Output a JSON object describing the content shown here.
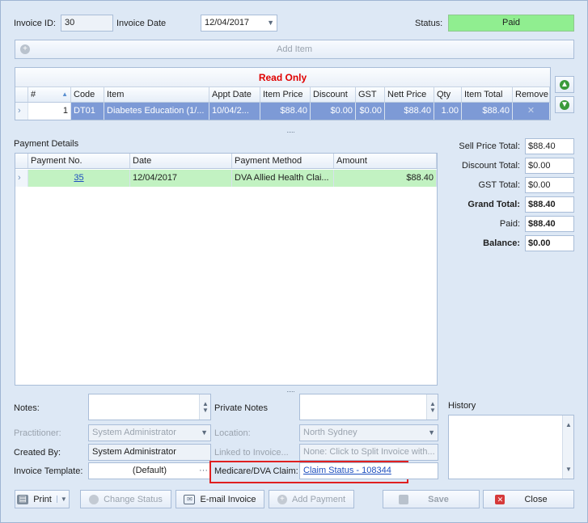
{
  "header": {
    "invoice_id_label": "Invoice ID:",
    "invoice_id_value": "30",
    "invoice_date_label": "Invoice Date",
    "invoice_date_value": "12/04/2017",
    "status_label": "Status:",
    "status_value": "Paid",
    "status_color": "#90ee90"
  },
  "add_item_label": "Add Item",
  "items_grid": {
    "banner": "Read Only",
    "banner_color": "#e00000",
    "columns": [
      "#",
      "Code",
      "Item",
      "Appt Date",
      "Item Price",
      "Discount",
      "GST",
      "Nett Price",
      "Qty",
      "Item Total",
      "Remove"
    ],
    "rows": [
      {
        "num": "1",
        "code": "DT01",
        "item": "Diabetes Education (1/...",
        "appt_date": "10/04/2...",
        "item_price": "$88.40",
        "discount": "$0.00",
        "gst": "$0.00",
        "nett_price": "$88.40",
        "qty": "1.00",
        "item_total": "$88.40",
        "remove": "✕"
      }
    ]
  },
  "payments": {
    "section_label": "Payment Details",
    "columns": [
      "Payment No.",
      "Date",
      "Payment Method",
      "Amount"
    ],
    "rows": [
      {
        "payment_no": "35",
        "date": "12/04/2017",
        "method": "DVA Allied Health Clai...",
        "amount": "$88.40"
      }
    ]
  },
  "totals": {
    "sell_price_label": "Sell Price Total:",
    "sell_price_value": "$88.40",
    "discount_label": "Discount Total:",
    "discount_value": "$0.00",
    "gst_label": "GST Total:",
    "gst_value": "$0.00",
    "grand_label": "Grand Total:",
    "grand_value": "$88.40",
    "paid_label": "Paid:",
    "paid_value": "$88.40",
    "balance_label": "Balance:",
    "balance_value": "$0.00"
  },
  "form": {
    "notes_label": "Notes:",
    "private_notes_label": "Private Notes",
    "history_label": "History",
    "practitioner_label": "Practitioner:",
    "practitioner_value": "System Administrator",
    "location_label": "Location:",
    "location_value": "North Sydney",
    "created_by_label": "Created By:",
    "created_by_value": "System Administrator",
    "linked_label": "Linked to Invoice...",
    "linked_value": "None: Click to Split Invoice with...",
    "template_label": "Invoice Template:",
    "template_value": "(Default)",
    "claim_label": "Medicare/DVA Claim:",
    "claim_value": "Claim Status - 108344",
    "highlight_color": "#e02020"
  },
  "buttons": {
    "print": "Print",
    "change_status": "Change Status",
    "email_invoice": "E-mail Invoice",
    "add_payment": "Add Payment",
    "save": "Save",
    "close": "Close"
  }
}
